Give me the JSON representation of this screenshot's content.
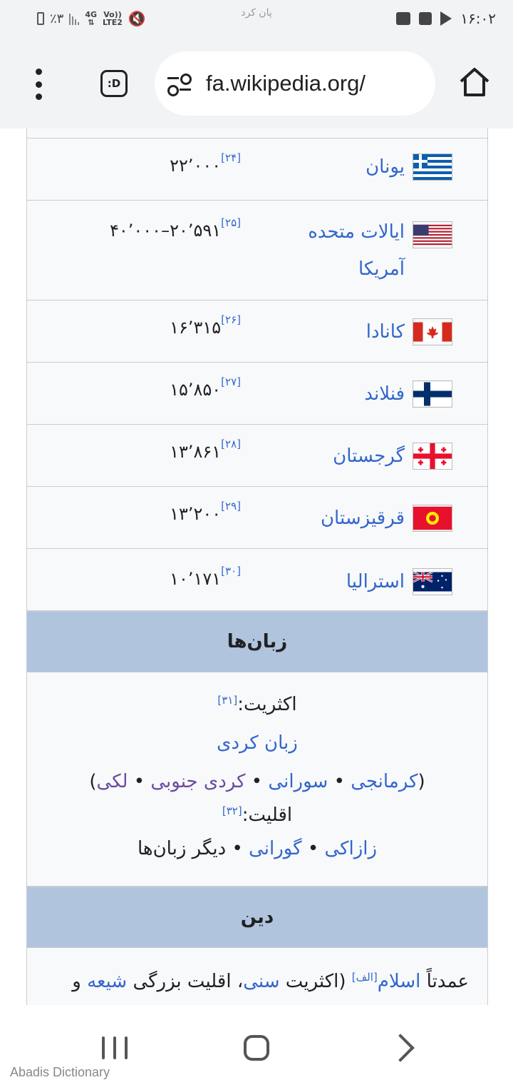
{
  "status_bar": {
    "battery": "٪۳",
    "network_4g": "4G",
    "volte": "Vo))",
    "lte2": "LTE2",
    "center_text": "پان کرد",
    "time": "۱۶:۰۲"
  },
  "browser": {
    "url": "fa.wikipedia.org/",
    "desktop_badge": ":D"
  },
  "diaspora_rows": [
    {
      "country": "یونان",
      "population": "۲۲٬۰۰۰",
      "ref": "[۲۴]",
      "flag": "greece"
    },
    {
      "country": "ایالات متحده آمریکا",
      "population": "۲۰٬۵۹۱–۴۰٬۰۰۰",
      "ref": "[۲۵]",
      "flag": "usa"
    },
    {
      "country": "کانادا",
      "population": "۱۶٬۳۱۵",
      "ref": "[۲۶]",
      "flag": "canada"
    },
    {
      "country": "فنلاند",
      "population": "۱۵٬۸۵۰",
      "ref": "[۲۷]",
      "flag": "finland"
    },
    {
      "country": "گرجستان",
      "population": "۱۳٬۸۶۱",
      "ref": "[۲۸]",
      "flag": "georgia"
    },
    {
      "country": "قرقیزستان",
      "population": "۱۳٬۲۰۰",
      "ref": "[۲۹]",
      "flag": "kyrgyzstan"
    },
    {
      "country": "استرالیا",
      "population": "۱۰٬۱۷۱",
      "ref": "[۳۰]",
      "flag": "australia"
    }
  ],
  "languages": {
    "heading": "زبان‌ها",
    "majority_label": "اکثریت:",
    "majority_ref": "[۳۱]",
    "main_language": "زبان کردی",
    "open_paren": "(",
    "close_paren": ")",
    "dialects": [
      "کرمانجی",
      "سورانی",
      "کردی جنوبی",
      "لکی"
    ],
    "separator": " • ",
    "minority_label": "اقلیت:",
    "minority_ref": "[۳۲]",
    "minority_links": [
      "زازاکی",
      "گورانی"
    ],
    "other_languages": "دیگر زبان‌ها"
  },
  "religion": {
    "heading": "دین",
    "prefix": "عمدتاً",
    "islam": "اسلام",
    "note_ref": "[الف]",
    "text_1": "(اکثریت",
    "sunni": "سنی",
    "text_2": "، اقلیت بزرگی",
    "shia": "شیعه",
    "text_3": "و"
  },
  "watermark": "Abadis Dictionary"
}
